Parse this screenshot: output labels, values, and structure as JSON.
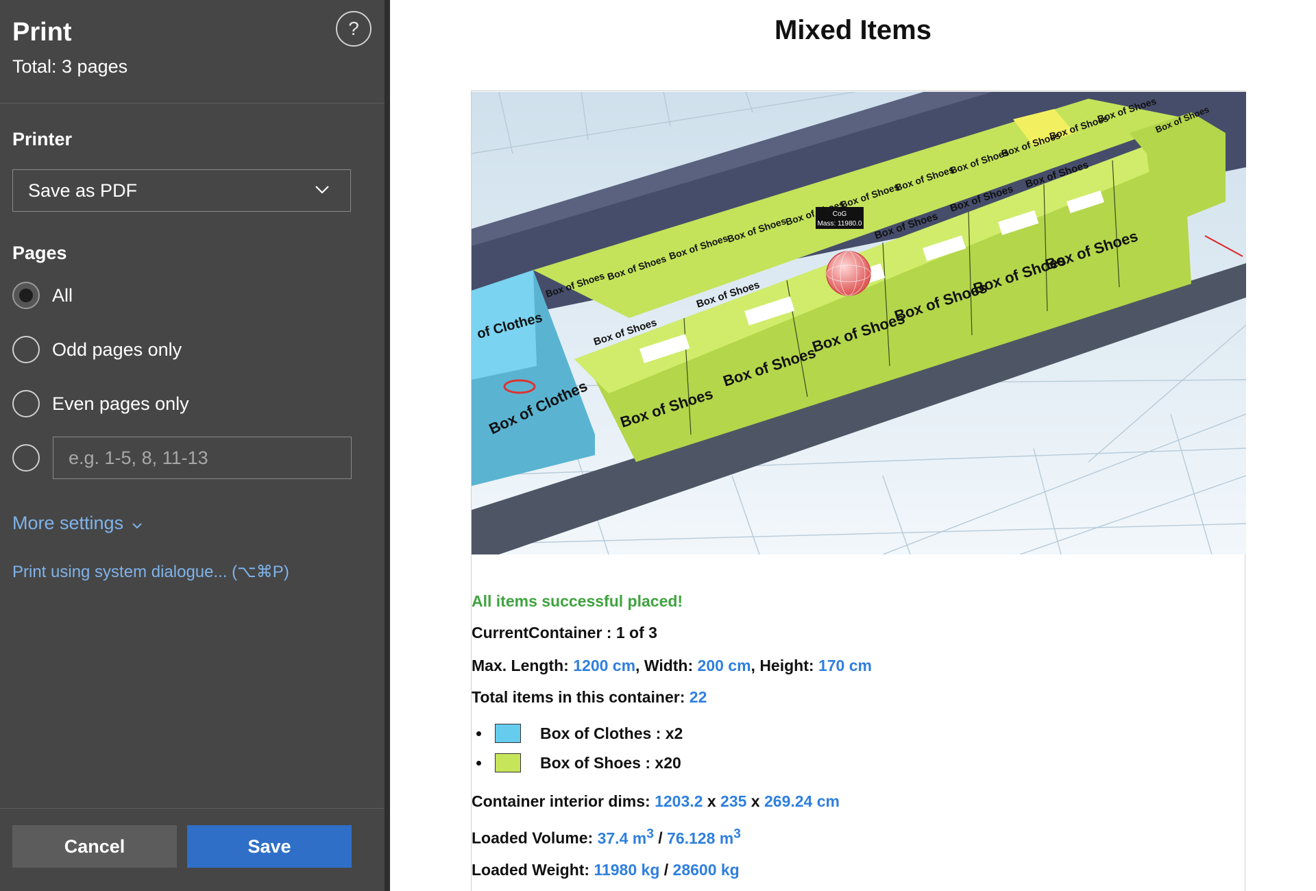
{
  "dialog": {
    "title": "Print",
    "total": "Total: 3 pages",
    "help_glyph": "?",
    "printer_label": "Printer",
    "printer_value": "Save as PDF",
    "pages_label": "Pages",
    "page_options": [
      "All",
      "Odd pages only",
      "Even pages only"
    ],
    "selected_option": "All",
    "range_placeholder": "e.g. 1-5, 8, 11-13",
    "more_settings": "More settings",
    "system_dialog": "Print using system dialogue... (⌥⌘P)",
    "cancel": "Cancel",
    "save": "Save"
  },
  "preview": {
    "title": "Mixed Items",
    "scene": {
      "tooltip_line1": "CoG",
      "tooltip_line2": "Mass: 11980.0",
      "box_clothes": "Box of Clothes",
      "box_clothes_partial": "of Clothes",
      "box_shoes": "Box of Shoes"
    },
    "status": "All items successful placed!",
    "current_container_label": "CurrentContainer : 1 of 3",
    "dims": {
      "max_length_label": "Max. Length:",
      "length": "1200 cm",
      "width_label": ", Width:",
      "width": "200 cm",
      "height_label": ", Height:",
      "height": "170 cm"
    },
    "total_items_label": "Total items in this container:",
    "total_items": "22",
    "legend": [
      {
        "label": "Box of Clothes : x2",
        "color": "#66ccee"
      },
      {
        "label": "Box of Shoes : x20",
        "color": "#c6e55a"
      }
    ],
    "interior": {
      "label": "Container interior dims:",
      "l": "1203.2",
      "x": "x",
      "w": "235",
      "h": "269.24 cm"
    },
    "volume": {
      "label": "Loaded Volume:",
      "loaded": "37.4 m",
      "sep": "/",
      "capacity": "76.128 m",
      "exp": "3"
    },
    "weight": {
      "label": "Loaded Weight:",
      "loaded": "11980 kg",
      "sep": "/",
      "capacity": "28600 kg"
    }
  }
}
